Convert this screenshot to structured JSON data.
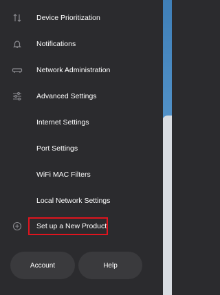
{
  "menu": {
    "items": [
      {
        "label": "Device Prioritization",
        "icon": "sort-arrows-icon"
      },
      {
        "label": "Notifications",
        "icon": "bell-icon"
      },
      {
        "label": "Network Administration",
        "icon": "router-icon"
      },
      {
        "label": "Advanced Settings",
        "icon": "sliders-icon"
      },
      {
        "label": "Internet Settings"
      },
      {
        "label": "Port Settings"
      },
      {
        "label": "WiFi MAC Filters"
      },
      {
        "label": "Local Network Settings"
      },
      {
        "label": "Set up a New Product",
        "icon": "plus-circle-icon"
      }
    ]
  },
  "footer": {
    "account_label": "Account",
    "help_label": "Help"
  },
  "colors": {
    "highlight_border": "#e0141e",
    "drawer_background": "#2b2b2e"
  }
}
